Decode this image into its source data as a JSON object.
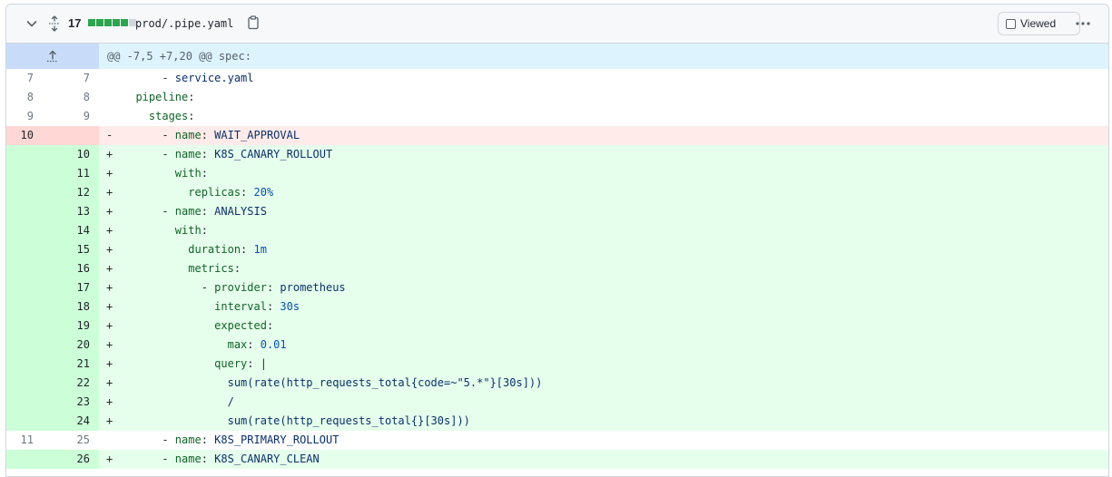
{
  "file": {
    "changes": "17",
    "diffstat": [
      "#2da44e",
      "#2da44e",
      "#2da44e",
      "#2da44e",
      "#2da44e",
      "#d0d7de"
    ],
    "filename": "prod/.pipe.yaml",
    "viewed_label": "Viewed",
    "viewed": false
  },
  "hunk": {
    "header": "@@ -7,5 +7,20 @@ spec:"
  },
  "colors": {
    "add_bg": "#e6ffec",
    "add_gutter": "#ccffd8",
    "del_bg": "#ffebe9",
    "del_gutter": "#ffd7d5",
    "hunk_bg": "#ddf4ff"
  },
  "lines": [
    {
      "type": "ctx",
      "old": "7",
      "new": "7",
      "mark": "",
      "code": [
        {
          "t": "      - ",
          "c": "p"
        },
        {
          "t": "service.yaml",
          "c": "v"
        }
      ]
    },
    {
      "type": "ctx",
      "old": "8",
      "new": "8",
      "mark": "",
      "code": [
        {
          "t": "  ",
          "c": "p"
        },
        {
          "t": "pipeline",
          "c": "k"
        },
        {
          "t": ":",
          "c": "p"
        }
      ]
    },
    {
      "type": "ctx",
      "old": "9",
      "new": "9",
      "mark": "",
      "code": [
        {
          "t": "    ",
          "c": "p"
        },
        {
          "t": "stages",
          "c": "k"
        },
        {
          "t": ":",
          "c": "p"
        }
      ]
    },
    {
      "type": "del",
      "old": "10",
      "new": "",
      "mark": "-",
      "code": [
        {
          "t": "      - ",
          "c": "p"
        },
        {
          "t": "name",
          "c": "k"
        },
        {
          "t": ": ",
          "c": "p"
        },
        {
          "t": "WAIT_APPROVAL",
          "c": "v"
        }
      ]
    },
    {
      "type": "add",
      "old": "",
      "new": "10",
      "mark": "+",
      "code": [
        {
          "t": "      - ",
          "c": "p"
        },
        {
          "t": "name",
          "c": "k"
        },
        {
          "t": ": ",
          "c": "p"
        },
        {
          "t": "K8S_CANARY_ROLLOUT",
          "c": "v"
        }
      ]
    },
    {
      "type": "add",
      "old": "",
      "new": "11",
      "mark": "+",
      "code": [
        {
          "t": "        ",
          "c": "p"
        },
        {
          "t": "with",
          "c": "k"
        },
        {
          "t": ":",
          "c": "p"
        }
      ]
    },
    {
      "type": "add",
      "old": "",
      "new": "12",
      "mark": "+",
      "code": [
        {
          "t": "          ",
          "c": "p"
        },
        {
          "t": "replicas",
          "c": "k"
        },
        {
          "t": ": ",
          "c": "p"
        },
        {
          "t": "20%",
          "c": "n"
        }
      ]
    },
    {
      "type": "add",
      "old": "",
      "new": "13",
      "mark": "+",
      "code": [
        {
          "t": "      - ",
          "c": "p"
        },
        {
          "t": "name",
          "c": "k"
        },
        {
          "t": ": ",
          "c": "p"
        },
        {
          "t": "ANALYSIS",
          "c": "v"
        }
      ]
    },
    {
      "type": "add",
      "old": "",
      "new": "14",
      "mark": "+",
      "code": [
        {
          "t": "        ",
          "c": "p"
        },
        {
          "t": "with",
          "c": "k"
        },
        {
          "t": ":",
          "c": "p"
        }
      ]
    },
    {
      "type": "add",
      "old": "",
      "new": "15",
      "mark": "+",
      "code": [
        {
          "t": "          ",
          "c": "p"
        },
        {
          "t": "duration",
          "c": "k"
        },
        {
          "t": ": ",
          "c": "p"
        },
        {
          "t": "1m",
          "c": "n"
        }
      ]
    },
    {
      "type": "add",
      "old": "",
      "new": "16",
      "mark": "+",
      "code": [
        {
          "t": "          ",
          "c": "p"
        },
        {
          "t": "metrics",
          "c": "k"
        },
        {
          "t": ":",
          "c": "p"
        }
      ]
    },
    {
      "type": "add",
      "old": "",
      "new": "17",
      "mark": "+",
      "code": [
        {
          "t": "            - ",
          "c": "p"
        },
        {
          "t": "provider",
          "c": "k"
        },
        {
          "t": ": ",
          "c": "p"
        },
        {
          "t": "prometheus",
          "c": "v"
        }
      ]
    },
    {
      "type": "add",
      "old": "",
      "new": "18",
      "mark": "+",
      "code": [
        {
          "t": "              ",
          "c": "p"
        },
        {
          "t": "interval",
          "c": "k"
        },
        {
          "t": ": ",
          "c": "p"
        },
        {
          "t": "30s",
          "c": "n"
        }
      ]
    },
    {
      "type": "add",
      "old": "",
      "new": "19",
      "mark": "+",
      "code": [
        {
          "t": "              ",
          "c": "p"
        },
        {
          "t": "expected",
          "c": "k"
        },
        {
          "t": ":",
          "c": "p"
        }
      ]
    },
    {
      "type": "add",
      "old": "",
      "new": "20",
      "mark": "+",
      "code": [
        {
          "t": "                ",
          "c": "p"
        },
        {
          "t": "max",
          "c": "k"
        },
        {
          "t": ": ",
          "c": "p"
        },
        {
          "t": "0.01",
          "c": "n"
        }
      ]
    },
    {
      "type": "add",
      "old": "",
      "new": "21",
      "mark": "+",
      "code": [
        {
          "t": "              ",
          "c": "p"
        },
        {
          "t": "query",
          "c": "k"
        },
        {
          "t": ": |",
          "c": "p"
        }
      ]
    },
    {
      "type": "add",
      "old": "",
      "new": "22",
      "mark": "+",
      "code": [
        {
          "t": "                sum(rate(http_requests_total{code=~\"5.*\"}[30s]))",
          "c": "v"
        }
      ]
    },
    {
      "type": "add",
      "old": "",
      "new": "23",
      "mark": "+",
      "code": [
        {
          "t": "                /",
          "c": "v"
        }
      ]
    },
    {
      "type": "add",
      "old": "",
      "new": "24",
      "mark": "+",
      "code": [
        {
          "t": "                sum(rate(http_requests_total{}[30s]))",
          "c": "v"
        }
      ]
    },
    {
      "type": "ctx",
      "old": "11",
      "new": "25",
      "mark": "",
      "code": [
        {
          "t": "      - ",
          "c": "p"
        },
        {
          "t": "name",
          "c": "k"
        },
        {
          "t": ": ",
          "c": "p"
        },
        {
          "t": "K8S_PRIMARY_ROLLOUT",
          "c": "v"
        }
      ]
    },
    {
      "type": "add",
      "old": "",
      "new": "26",
      "mark": "+",
      "code": [
        {
          "t": "      - ",
          "c": "p"
        },
        {
          "t": "name",
          "c": "k"
        },
        {
          "t": ": ",
          "c": "p"
        },
        {
          "t": "K8S_CANARY_CLEAN",
          "c": "v"
        }
      ]
    }
  ]
}
